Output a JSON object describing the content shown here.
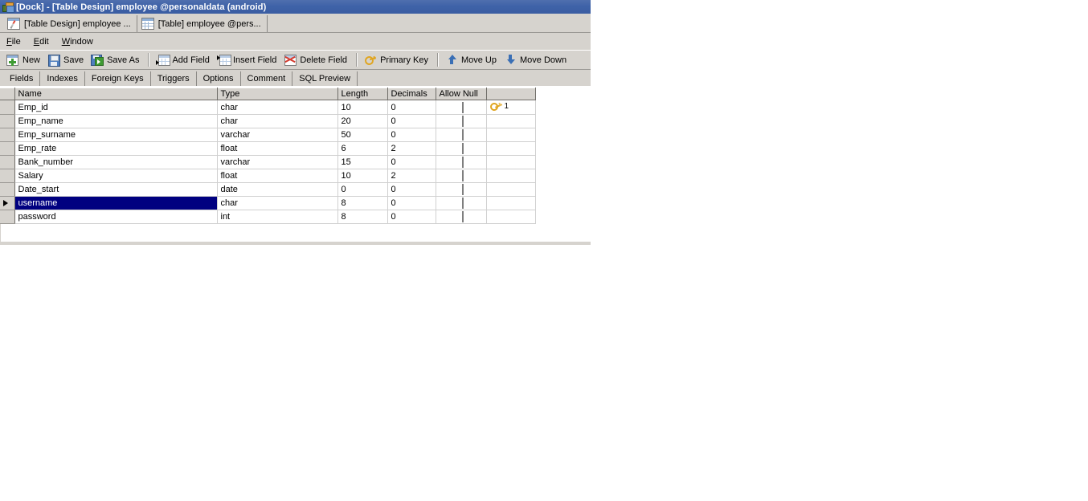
{
  "window": {
    "title": "[Dock] - [Table Design] employee @personaldata (android)",
    "icon": "navicat-app-icon"
  },
  "document_tabs": [
    {
      "label": "[Table Design] employee ...",
      "icon": "table-design-icon",
      "active": true
    },
    {
      "label": "[Table] employee @pers...",
      "icon": "table-icon",
      "active": false
    }
  ],
  "menubar": {
    "items": [
      {
        "label": "File",
        "mnemonic": "F"
      },
      {
        "label": "Edit",
        "mnemonic": "E"
      },
      {
        "label": "Window",
        "mnemonic": "W"
      }
    ]
  },
  "toolbar": {
    "groups": [
      {
        "buttons": [
          {
            "label": "New",
            "icon": "new-table-icon"
          },
          {
            "label": "Save",
            "icon": "save-floppy-icon"
          },
          {
            "label": "Save As",
            "icon": "save-as-icon"
          }
        ]
      },
      {
        "buttons": [
          {
            "label": "Add Field",
            "icon": "add-field-icon"
          },
          {
            "label": "Insert Field",
            "icon": "insert-field-icon"
          },
          {
            "label": "Delete Field",
            "icon": "delete-field-icon"
          }
        ]
      },
      {
        "buttons": [
          {
            "label": "Primary Key",
            "icon": "primary-key-icon"
          }
        ]
      },
      {
        "buttons": [
          {
            "label": "Move Up",
            "icon": "arrow-up-icon"
          },
          {
            "label": "Move Down",
            "icon": "arrow-down-icon"
          }
        ]
      }
    ]
  },
  "section_tabs": [
    {
      "label": "Fields",
      "active": true
    },
    {
      "label": "Indexes",
      "active": false
    },
    {
      "label": "Foreign Keys",
      "active": false
    },
    {
      "label": "Triggers",
      "active": false
    },
    {
      "label": "Options",
      "active": false
    },
    {
      "label": "Comment",
      "active": false
    },
    {
      "label": "SQL Preview",
      "active": false
    }
  ],
  "grid": {
    "columns": [
      {
        "key": "name",
        "label": "Name"
      },
      {
        "key": "type",
        "label": "Type"
      },
      {
        "key": "length",
        "label": "Length"
      },
      {
        "key": "decimals",
        "label": "Decimals"
      },
      {
        "key": "allow_null",
        "label": "Allow Null"
      },
      {
        "key": "key",
        "label": ""
      }
    ],
    "rows": [
      {
        "name": "Emp_id",
        "type": "char",
        "length": "10",
        "decimals": "0",
        "allow_null": false,
        "key": "1",
        "selected": false
      },
      {
        "name": "Emp_name",
        "type": "char",
        "length": "20",
        "decimals": "0",
        "allow_null": false,
        "key": "",
        "selected": false
      },
      {
        "name": "Emp_surname",
        "type": "varchar",
        "length": "50",
        "decimals": "0",
        "allow_null": false,
        "key": "",
        "selected": false
      },
      {
        "name": "Emp_rate",
        "type": "float",
        "length": "6",
        "decimals": "2",
        "allow_null": false,
        "key": "",
        "selected": false
      },
      {
        "name": "Bank_number",
        "type": "varchar",
        "length": "15",
        "decimals": "0",
        "allow_null": false,
        "key": "",
        "selected": false
      },
      {
        "name": "Salary",
        "type": "float",
        "length": "10",
        "decimals": "2",
        "allow_null": false,
        "key": "",
        "selected": false
      },
      {
        "name": "Date_start",
        "type": "date",
        "length": "0",
        "decimals": "0",
        "allow_null": false,
        "key": "",
        "selected": false
      },
      {
        "name": "username",
        "type": "char",
        "length": "8",
        "decimals": "0",
        "allow_null": false,
        "key": "",
        "selected": true
      },
      {
        "name": "password",
        "type": "int",
        "length": "8",
        "decimals": "0",
        "allow_null": false,
        "key": "",
        "selected": false
      }
    ]
  },
  "colors": {
    "titlebar": "#3f63a8",
    "chrome": "#d6d3ce",
    "selection": "#000080",
    "key": "#e0a520"
  }
}
